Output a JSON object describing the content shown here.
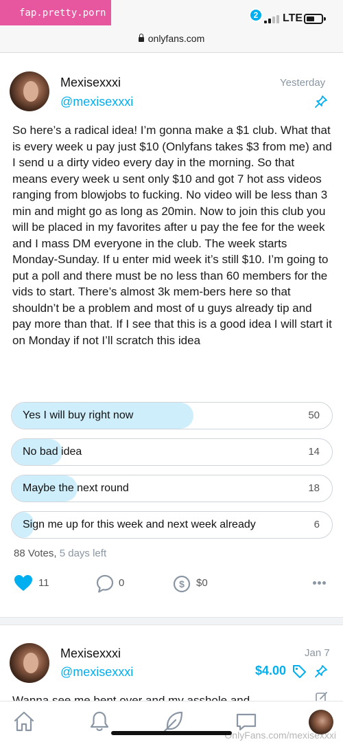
{
  "watermark": "fap.pretty.porn",
  "status_bar": {
    "network": "LTE"
  },
  "browser": {
    "url": "onlyfans.com"
  },
  "colors": {
    "accent": "#00aff0",
    "poll_fill": "#cfeefb",
    "watermark_bg": "#e6579f"
  },
  "post": {
    "author_name": "Mexisexxxi",
    "author_handle": "@mexisexxxi",
    "time": "Yesterday",
    "text": "So here’s a radical idea! I’m gonna make a $1 club. What that is every week u pay just $10 (Onlyfans takes $3 from me) and I send u a dirty video every day in the morning. So that means every week u sent only $10 and got 7 hot ass videos ranging from blowjobs to fucking. No video will be less than 3 min and might go as long as 20min. Now to join this club you will be placed in my favorites after u pay the fee for the week and I mass DM everyone in the club. The week starts Monday-Sunday. If u enter mid week it’s still $10. I’m going to put a poll and there must be no less than 60 members for the vids to start. There’s almost 3k mem-bers here so that shouldn’t be a problem and most of u guys already tip and pay more than that. If I see that this is a good idea I will start it on Monday if not I’ll scratch this idea",
    "poll": {
      "options": [
        {
          "label": "Yes I will buy right now",
          "count": "50",
          "fraction": 0.568
        },
        {
          "label": "No bad idea",
          "count": "14",
          "fraction": 0.159
        },
        {
          "label": "Maybe the next round",
          "count": "18",
          "fraction": 0.205
        },
        {
          "label": "Sign me up for this week and next week already",
          "count": "6",
          "fraction": 0.068
        }
      ],
      "votes": "88 Votes,",
      "time_left": "5 days left"
    },
    "likes": "11",
    "comments": "0",
    "tips": "$0"
  },
  "post2": {
    "author_name": "Mexisexxxi",
    "author_handle": "@mexisexxxi",
    "time": "Jan 7",
    "price": "$4.00",
    "text": "Wanna see me bent over and my asshole and"
  },
  "bottom_nav": {
    "items": [
      "home-icon",
      "bell-icon",
      "feather-icon",
      "messages-icon",
      "profile-avatar"
    ],
    "messages_badge": "2"
  },
  "footer_watermark": "OnlyFans.com/mexisexxxi"
}
